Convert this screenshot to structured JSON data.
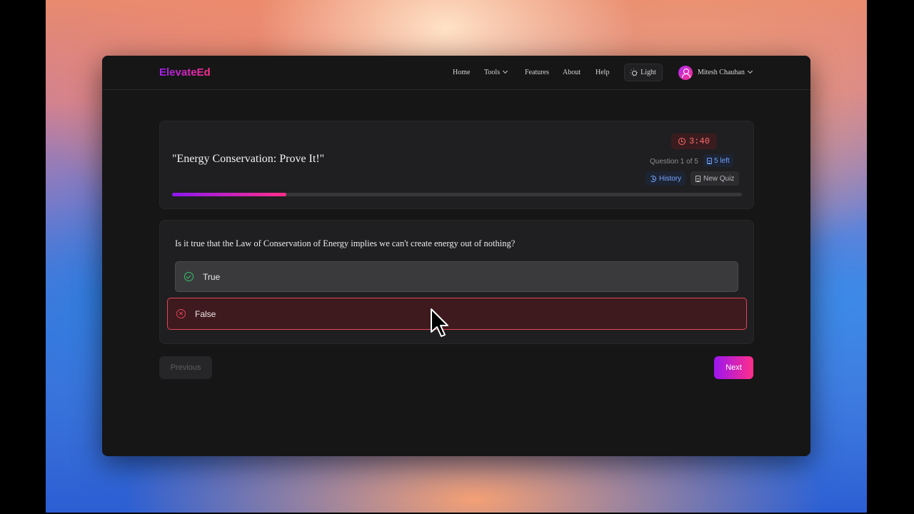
{
  "app": {
    "logo": "ElevateEd"
  },
  "nav": {
    "home": "Home",
    "tools": "Tools",
    "features": "Features",
    "about": "About",
    "help": "Help",
    "theme_toggle": "Light",
    "user_name": "Mitesh Chauhan"
  },
  "quiz": {
    "title": "\"Energy Conservation: Prove It!\"",
    "timer": "3:40",
    "question_count": "Question 1 of 5",
    "remaining": "5 left",
    "history_label": "History",
    "new_quiz_label": "New Quiz",
    "progress": 0.2
  },
  "question": {
    "text": "Is it true that the Law of Conservation of Energy implies we can't create energy out of nothing?",
    "options": [
      {
        "label": "True",
        "state": "correct",
        "icon": "check-circle-icon"
      },
      {
        "label": "False",
        "state": "incorrect",
        "icon": "x-circle-icon"
      }
    ]
  },
  "footer": {
    "previous_label": "Previous",
    "next_label": "Next"
  },
  "colors": {
    "accent_start": "#9b16f0",
    "accent_end": "#ff2e8a",
    "correct": "#35c46a",
    "incorrect": "#e2455a",
    "timer_text": "#ff6b6b",
    "info_blue": "#6fa0ff"
  }
}
